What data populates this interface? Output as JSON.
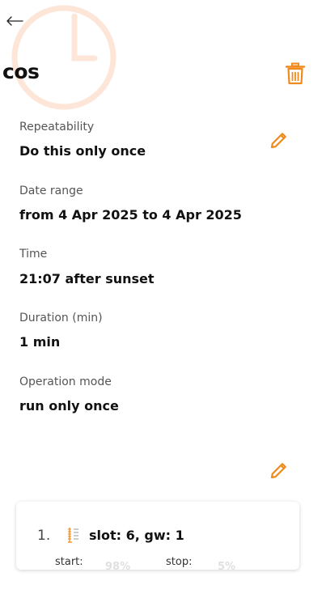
{
  "header": {
    "back_icon": "arrow-left-icon",
    "title": "cos",
    "watermark_icon": "clock-icon",
    "delete_icon": "trash-icon",
    "accent_color": "#f08a1c"
  },
  "details": {
    "repeatability": {
      "label": "Repeatability",
      "value": "Do this only once"
    },
    "date_range": {
      "label": "Date range",
      "value": "from 4 Apr 2025 to 4 Apr 2025"
    },
    "time": {
      "label": "Time",
      "value": "21:07 after sunset"
    },
    "duration": {
      "label": "Duration (min)",
      "value": "1 min"
    },
    "operation_mode": {
      "label": "Operation mode",
      "value": "run only once"
    },
    "edit_icon": "pencil-icon"
  },
  "slots": {
    "edit_icon": "pencil-icon",
    "items": [
      {
        "index": "1.",
        "icon": "blinds-icon",
        "label": "slot: 6, gw: 1",
        "start_label": "start:",
        "start_value": "98%",
        "stop_label": "stop:",
        "stop_value": "5%"
      }
    ]
  }
}
